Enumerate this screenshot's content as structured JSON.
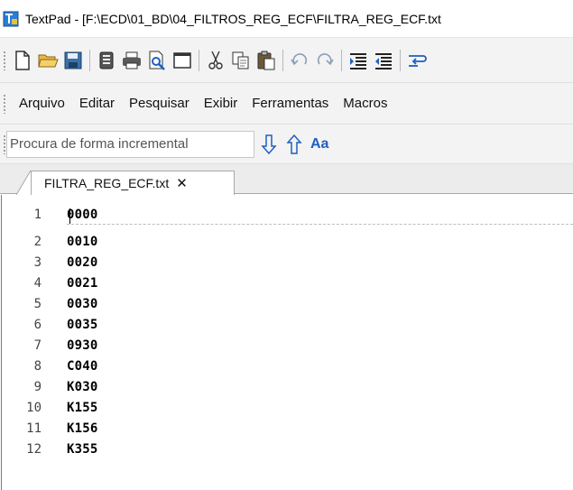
{
  "window": {
    "title": "TextPad - [F:\\ECD\\01_BD\\04_FILTROS_REG_ECF\\FILTRA_REG_ECF.txt"
  },
  "toolbar": {
    "buttons": [
      "new-file",
      "open-file",
      "save",
      "print-setup",
      "print",
      "print-preview",
      "window",
      "cut",
      "copy",
      "paste",
      "undo",
      "redo",
      "indent",
      "outdent",
      "wrap"
    ]
  },
  "menu": {
    "items": [
      "Arquivo",
      "Editar",
      "Pesquisar",
      "Exibir",
      "Ferramentas",
      "Macros"
    ]
  },
  "search": {
    "placeholder": "Procura de forma incremental",
    "match_case_label": "Aa"
  },
  "tabs": [
    {
      "label": "FILTRA_REG_ECF.txt",
      "close": "✕"
    }
  ],
  "editor": {
    "lines": [
      {
        "n": "1",
        "text": "0000"
      },
      {
        "n": "2",
        "text": "0010"
      },
      {
        "n": "3",
        "text": "0020"
      },
      {
        "n": "4",
        "text": "0021"
      },
      {
        "n": "5",
        "text": "0030"
      },
      {
        "n": "6",
        "text": "0035"
      },
      {
        "n": "7",
        "text": "0930"
      },
      {
        "n": "8",
        "text": "C040"
      },
      {
        "n": "9",
        "text": "K030"
      },
      {
        "n": "10",
        "text": "K155"
      },
      {
        "n": "11",
        "text": "K156"
      },
      {
        "n": "12",
        "text": "K355"
      }
    ]
  },
  "colors": {
    "accent_blue": "#1f5fbf",
    "toolbar_bg": "#f3f3f3"
  }
}
